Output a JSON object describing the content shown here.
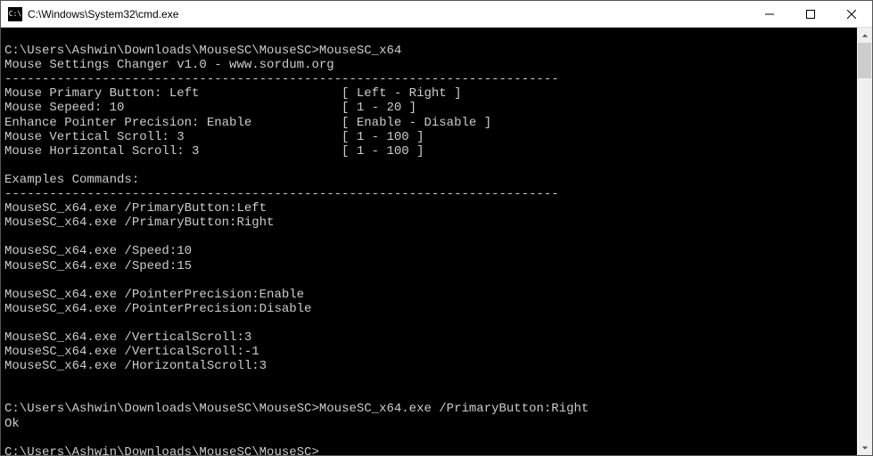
{
  "title": "C:\\Windows\\System32\\cmd.exe",
  "icon_text": "C:\\",
  "terminal": {
    "line1_prompt": "C:\\Users\\Ashwin\\Downloads\\MouseSC\\MouseSC>",
    "line1_cmd": "MouseSC_x64",
    "header": "Mouse Settings Changer v1.0 - www.sordum.org",
    "dash": "--------------------------------------------------------------------------",
    "setting1": "Mouse Primary Button: Left                   [ Left - Right ]",
    "setting2": "Mouse Sepeed: 10                             [ 1 - 20 ]",
    "setting3": "Enhance Pointer Precision: Enable            [ Enable - Disable ]",
    "setting4": "Mouse Vertical Scroll: 3                     [ 1 - 100 ]",
    "setting5": "Mouse Horizontal Scroll: 3                   [ 1 - 100 ]",
    "examples_header": "Examples Commands:",
    "ex1": "MouseSC_x64.exe /PrimaryButton:Left",
    "ex2": "MouseSC_x64.exe /PrimaryButton:Right",
    "ex3": "MouseSC_x64.exe /Speed:10",
    "ex4": "MouseSC_x64.exe /Speed:15",
    "ex5": "MouseSC_x64.exe /PointerPrecision:Enable",
    "ex6": "MouseSC_x64.exe /PointerPrecision:Disable",
    "ex7": "MouseSC_x64.exe /VerticalScroll:3",
    "ex8": "MouseSC_x64.exe /VerticalScroll:-1",
    "ex9": "MouseSC_x64.exe /HorizontalScroll:3",
    "line2_prompt": "C:\\Users\\Ashwin\\Downloads\\MouseSC\\MouseSC>",
    "line2_cmd": "MouseSC_x64.exe /PrimaryButton:Right",
    "ok": "Ok",
    "line3_prompt": "C:\\Users\\Ashwin\\Downloads\\MouseSC\\MouseSC>"
  }
}
